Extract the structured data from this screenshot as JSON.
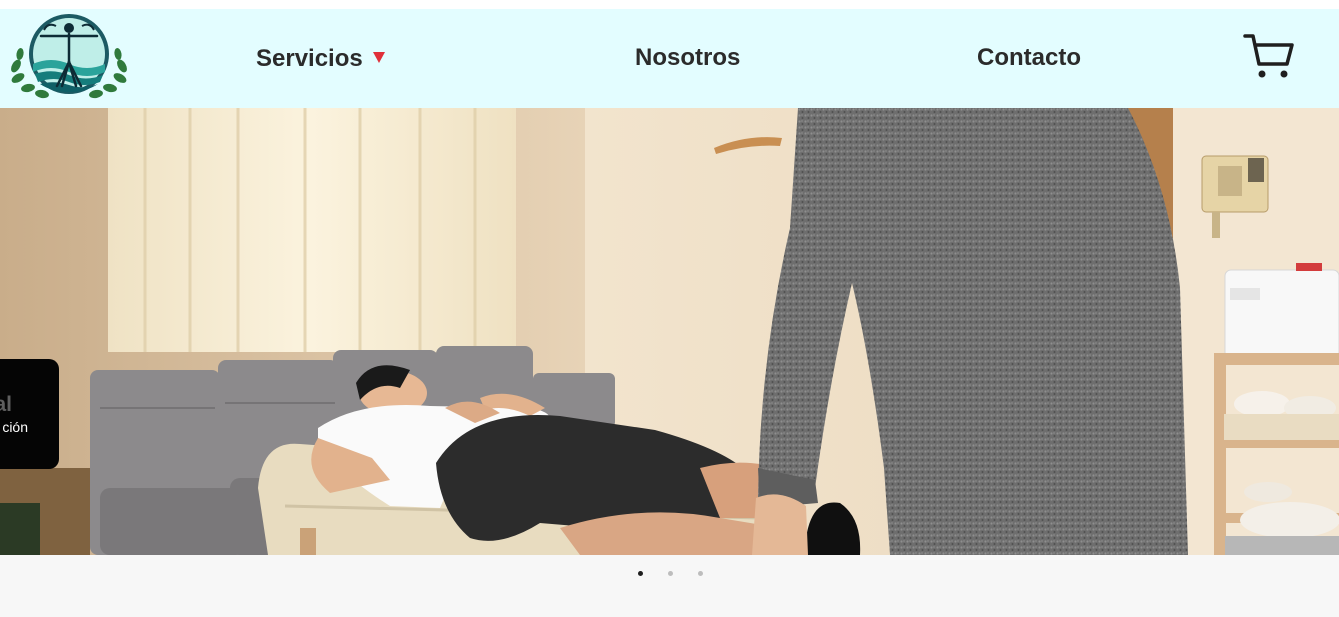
{
  "navbar": {
    "logo_icon": "physio-vitruvian-logo-icon",
    "items": [
      {
        "label": "Servicios",
        "has_dropdown": true,
        "caret_icon": "triangle-down-icon",
        "caret_color": "#e0303a"
      },
      {
        "label": "Nosotros"
      },
      {
        "label": "Contacto"
      }
    ],
    "cart_icon": "shopping-cart-icon",
    "background": "#e3fdff"
  },
  "hero": {
    "image": "physiotherapy-treatment-room-photo",
    "slide_caption": {
      "title": "al",
      "subtitle": "ción"
    }
  },
  "carousel": {
    "slides": 3,
    "active_index": 0
  },
  "colors": {
    "nav_text": "#2b2b2b",
    "caption_bg": "#050505",
    "page_bg": "#f7f7f7"
  }
}
